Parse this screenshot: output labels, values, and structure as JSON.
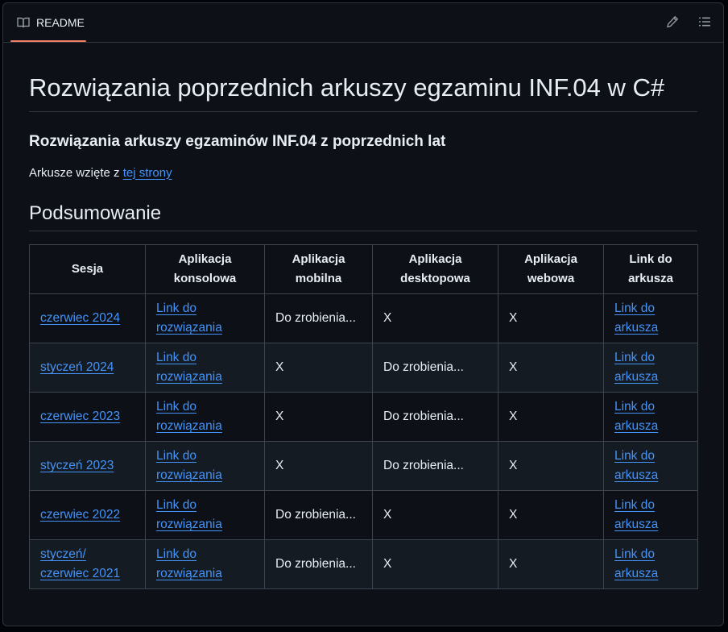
{
  "header": {
    "tab_label": "README",
    "tab_icon": "book-icon",
    "edit_icon": "pencil-icon",
    "outline_icon": "list-icon"
  },
  "readme": {
    "title": "Rozwiązania poprzednich arkuszy egzaminu INF.04 w C#",
    "subtitle": "Rozwiązania arkuszy egzaminów INF.04 z poprzednich lat",
    "note_prefix": "Arkusze wzięte z ",
    "note_link": "tej strony",
    "section_title": "Podsumowanie"
  },
  "table": {
    "headers": [
      [
        "Sesja"
      ],
      [
        "Aplikacja",
        "konsolowa"
      ],
      [
        "Aplikacja",
        "mobilna"
      ],
      [
        "Aplikacja",
        "desktopowa"
      ],
      [
        "Aplikacja",
        "webowa"
      ],
      [
        "Link do",
        "arkusza"
      ]
    ],
    "rows": [
      {
        "session": [
          "czerwiec 2024"
        ],
        "console": [
          "Link do",
          "rozwiązania"
        ],
        "mobile": "Do zrobienia...",
        "desktop": "X",
        "web": "X",
        "sheet": [
          "Link do",
          "arkusza"
        ]
      },
      {
        "session": [
          "styczeń 2024"
        ],
        "console": [
          "Link do",
          "rozwiązania"
        ],
        "mobile": "X",
        "desktop": "Do zrobienia...",
        "web": "X",
        "sheet": [
          "Link do",
          "arkusza"
        ]
      },
      {
        "session": [
          "czerwiec 2023"
        ],
        "console": [
          "Link do",
          "rozwiązania"
        ],
        "mobile": "X",
        "desktop": "Do zrobienia...",
        "web": "X",
        "sheet": [
          "Link do",
          "arkusza"
        ]
      },
      {
        "session": [
          "styczeń 2023"
        ],
        "console": [
          "Link do",
          "rozwiązania"
        ],
        "mobile": "X",
        "desktop": "Do zrobienia...",
        "web": "X",
        "sheet": [
          "Link do",
          "arkusza"
        ]
      },
      {
        "session": [
          "czerwiec 2022"
        ],
        "console": [
          "Link do",
          "rozwiązania"
        ],
        "mobile": "Do zrobienia...",
        "desktop": "X",
        "web": "X",
        "sheet": [
          "Link do",
          "arkusza"
        ]
      },
      {
        "session": [
          "styczeń/",
          "czerwiec 2021"
        ],
        "console": [
          "Link do",
          "rozwiązania"
        ],
        "mobile": "Do zrobienia...",
        "desktop": "X",
        "web": "X",
        "sheet": [
          "Link do",
          "arkusza"
        ]
      }
    ]
  },
  "colors": {
    "background": "#0d1117",
    "border": "#30363d",
    "link": "#4493f8",
    "tab_underline": "#f78166",
    "text": "#e6edf3"
  }
}
